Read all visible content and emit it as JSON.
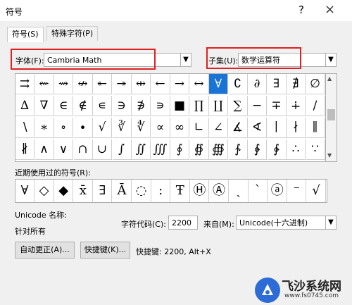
{
  "window": {
    "title": "符号",
    "help": "?",
    "close": "×"
  },
  "tabs": [
    "符号(S)",
    "特殊字符(P)"
  ],
  "font": {
    "label": "字体(F):",
    "value": "Cambria Math"
  },
  "subset": {
    "label": "子集(U):",
    "value": "数学运算符"
  },
  "symbols": [
    [
      "⇉",
      "⇜",
      "⇝",
      "↮",
      "↞",
      "↠",
      "⇹",
      "←",
      "→",
      "↔",
      "∀",
      "∁",
      "∂",
      "∃",
      "∄",
      "∅"
    ],
    [
      "∆",
      "∇",
      "∈",
      "∉",
      "∊",
      "∋",
      "∌",
      "∍",
      "■",
      "∏",
      "∐",
      "∑",
      "−",
      "∓",
      "∔",
      "∕"
    ],
    [
      "∖",
      "∗",
      "∘",
      "∙",
      "√",
      "∛",
      "∜",
      "∝",
      "∞",
      "∟",
      "∠",
      "∡",
      "∢",
      "∣",
      "∤",
      "∥"
    ],
    [
      "∦",
      "∧",
      "∨",
      "∩",
      "∪",
      "∫",
      "∬",
      "∭",
      "∮",
      "∯",
      "∰",
      "∱",
      "∲",
      "∳",
      "∴",
      "∵"
    ]
  ],
  "selected_symbol": "∀",
  "recent": {
    "label": "近期使用过的符号(R):",
    "symbols": [
      "∀",
      "◇",
      "◆",
      "x̄",
      "∃",
      "Ā",
      "◌",
      ":",
      "Ŧ",
      "Ⓗ",
      "Ⓐ",
      "ˎ",
      "ˋ",
      "ⓐ",
      "⁻",
      "√"
    ]
  },
  "unicode": {
    "label": "Unicode 名称:",
    "name": "针对所有"
  },
  "charcode": {
    "label": "字符代码(C):",
    "value": "2200"
  },
  "from": {
    "label": "来自(M):",
    "value": "Unicode(十六进制)"
  },
  "buttons": {
    "autocorrect": "自动更正(A)...",
    "shortcut": "快捷键(K)..."
  },
  "shortcut_text": "快捷键: 2200, Alt+X",
  "watermark": {
    "name": "飞沙系统网",
    "url": "www.fs0745.com"
  }
}
